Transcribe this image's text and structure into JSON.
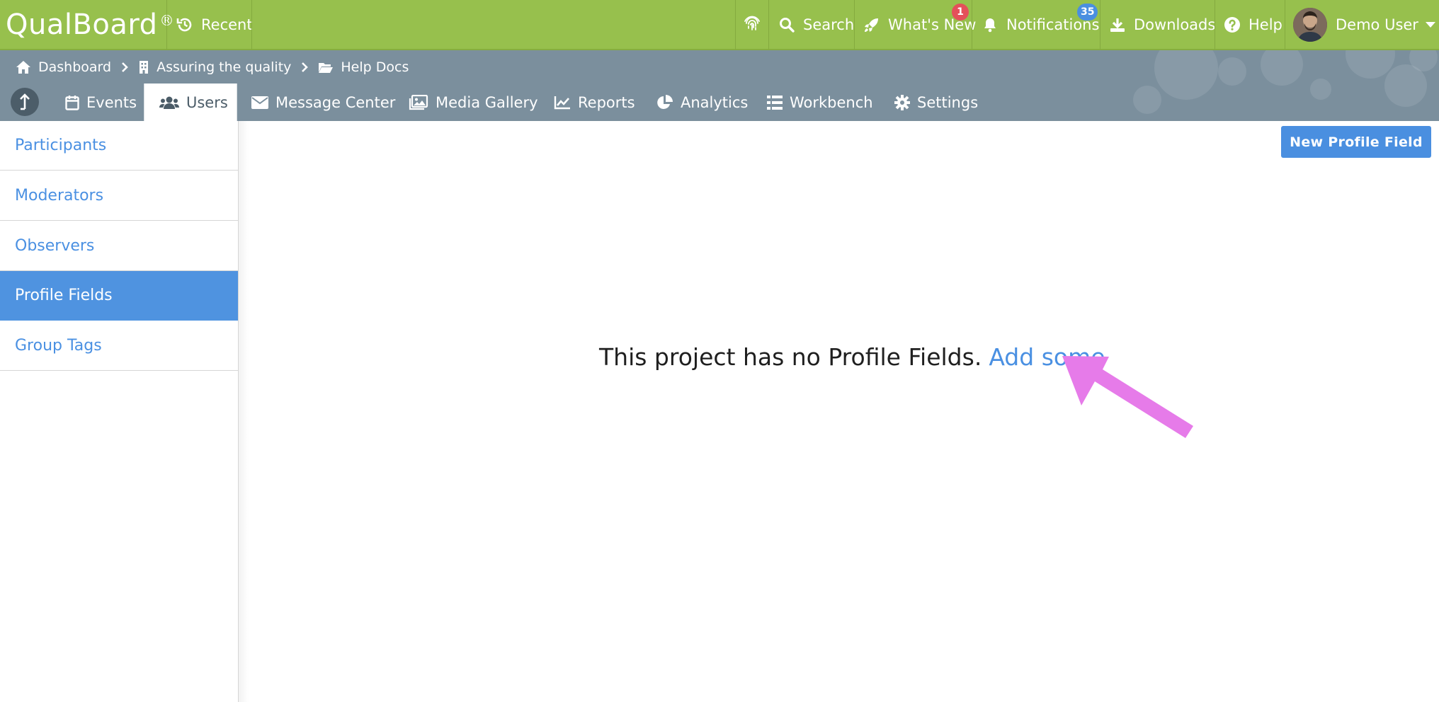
{
  "app": {
    "logo": "QualBoard",
    "logo_mark": "®"
  },
  "topbar": {
    "recent": "Recent",
    "search": "Search",
    "whats_new": "What's New",
    "whats_new_badge": "1",
    "notifications": "Notifications",
    "notifications_badge": "35",
    "downloads": "Downloads",
    "help": "Help",
    "user": "Demo User"
  },
  "breadcrumb": [
    "Dashboard",
    "Assuring the quality",
    "Help Docs"
  ],
  "tabs": [
    {
      "label": "Events",
      "icon": "calendar-icon"
    },
    {
      "label": "Users",
      "icon": "users-icon",
      "active": true
    },
    {
      "label": "Message Center",
      "icon": "envelope-icon"
    },
    {
      "label": "Media Gallery",
      "icon": "images-icon"
    },
    {
      "label": "Reports",
      "icon": "line-chart-icon"
    },
    {
      "label": "Analytics",
      "icon": "pie-chart-icon"
    },
    {
      "label": "Workbench",
      "icon": "list-icon"
    },
    {
      "label": "Settings",
      "icon": "gear-icon"
    }
  ],
  "sidebar": {
    "items": [
      {
        "label": "Participants"
      },
      {
        "label": "Moderators"
      },
      {
        "label": "Observers"
      },
      {
        "label": "Profile Fields",
        "active": true
      },
      {
        "label": "Group Tags"
      }
    ]
  },
  "main": {
    "new_button": "New Profile Field",
    "empty_text": "This project has no Profile Fields.",
    "empty_link": "Add some"
  },
  "colors": {
    "topbar": "#97c04d",
    "subbar": "#7b8f9d",
    "accent": "#4a90e2",
    "annotation_arrow": "#e67be9"
  }
}
